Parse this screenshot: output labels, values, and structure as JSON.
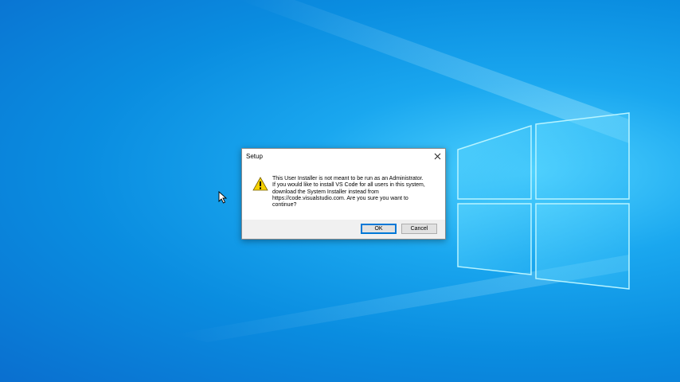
{
  "desktop": {
    "colors": {
      "background": "#0a8de0",
      "logo_pane": "#7ee6ff"
    }
  },
  "dialog": {
    "title": "Setup",
    "icon": "warning-icon",
    "message": "This User Installer is not meant to be run as an Administrator.\nIf you would like to install VS Code for all users in this system,\ndownload the System Installer instead from\nhttps://code.visualstudio.com. Are you sure you want to\ncontinue?",
    "ok_label": "OK",
    "cancel_label": "Cancel",
    "close_icon": "close-icon"
  }
}
